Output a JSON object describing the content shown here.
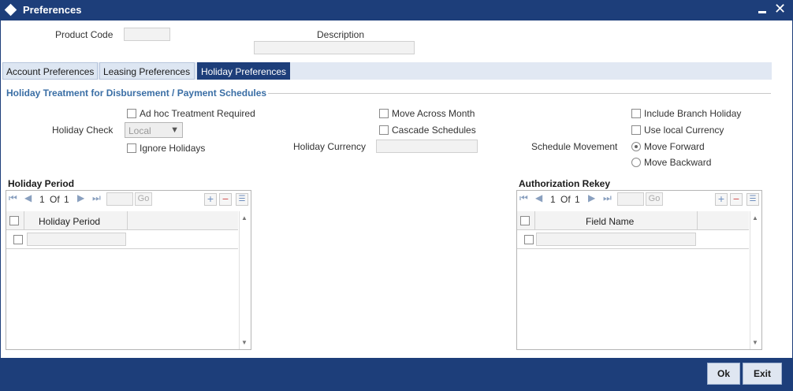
{
  "window": {
    "title": "Preferences"
  },
  "header": {
    "product_code_label": "Product Code",
    "product_code_value": "",
    "description_label": "Description",
    "description_value": ""
  },
  "tabs": [
    {
      "label": "Account Preferences",
      "active": false
    },
    {
      "label": "Leasing Preferences",
      "active": false
    },
    {
      "label": "Holiday Preferences",
      "active": true
    }
  ],
  "section": {
    "title": "Holiday Treatment for Disbursement / Payment Schedules"
  },
  "holiday": {
    "adhoc_label": "Ad hoc Treatment Required",
    "adhoc_checked": false,
    "holiday_check_label": "Holiday Check",
    "holiday_check_value": "Local",
    "ignore_label": "Ignore Holidays",
    "ignore_checked": false,
    "move_across_label": "Move Across Month",
    "move_across_checked": false,
    "cascade_label": "Cascade Schedules",
    "cascade_checked": false,
    "holiday_currency_label": "Holiday Currency",
    "holiday_currency_value": "",
    "include_branch_label": "Include Branch Holiday",
    "include_branch_checked": false,
    "use_local_label": "Use local Currency",
    "use_local_checked": false,
    "schedule_movement_label": "Schedule Movement",
    "move_forward_label": "Move Forward",
    "move_backward_label": "Move Backward",
    "schedule_movement_selected": "Move Forward"
  },
  "holiday_period_grid": {
    "title": "Holiday Period",
    "page_current": "1",
    "page_of": "Of",
    "page_total": "1",
    "go_label": "Go",
    "column": "Holiday Period"
  },
  "auth_rekey_grid": {
    "title": "Authorization Rekey",
    "page_current": "1",
    "page_of": "Of",
    "page_total": "1",
    "go_label": "Go",
    "column": "Field Name"
  },
  "footer": {
    "ok_label": "Ok",
    "exit_label": "Exit"
  },
  "icons": {
    "window": "diamond-icon",
    "minimize": "minimize-icon",
    "close": "close-icon",
    "first": "first-page-icon",
    "prev": "prev-page-icon",
    "next": "next-page-icon",
    "last": "last-page-icon",
    "add": "add-row-icon",
    "delete": "delete-row-icon",
    "view": "single-view-icon"
  },
  "colors": {
    "titlebar": "#1d3e7a",
    "section_title": "#3a6ea5",
    "tab_active": "#1d3e7a"
  }
}
